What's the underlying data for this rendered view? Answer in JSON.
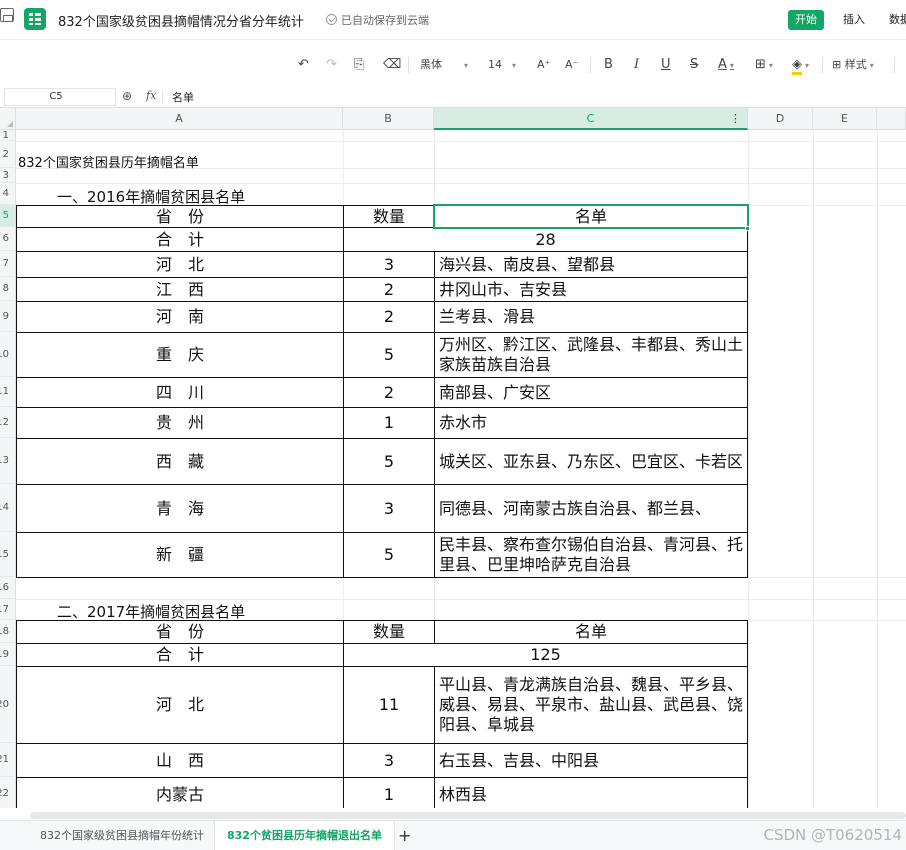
{
  "titlebar": {
    "doc_title": "832个国家级贫困县摘帽情况分省分年统计",
    "save_status": "已自动保存到云端",
    "menu": [
      "开始",
      "插入",
      "数据"
    ]
  },
  "toolbar": {
    "font_name": "黑体",
    "font_size": "14",
    "increase_font": "A⁺",
    "decrease_font": "A⁻",
    "bold": "B",
    "italic": "I",
    "underline": "U",
    "strikethrough": "S",
    "font_color": "A",
    "style_label": "样式",
    "icons": [
      "undo-icon",
      "redo-icon",
      "format-painter-icon",
      "eraser-icon",
      "border-icon",
      "fill-color-icon",
      "style-icon"
    ]
  },
  "formula_bar": {
    "cell_ref": "C5",
    "fx_label": "fx",
    "value": "名单"
  },
  "columns": [
    "A",
    "B",
    "C",
    "D",
    "E"
  ],
  "selected_column": "C",
  "rows": [
    "1",
    "2",
    "3",
    "4",
    "5",
    "6",
    "7",
    "8",
    "9",
    "10",
    "11",
    "12",
    "13",
    "14",
    "15",
    "16",
    "17",
    "18",
    "19",
    "20",
    "21",
    "22"
  ],
  "selected_row": "5",
  "sheet": {
    "heading": "832个国家贫困县历年摘帽名单",
    "section_2016": "一、2016年摘帽贫困县名单",
    "section_2017": "二、2017年摘帽贫困县名单",
    "table_headers": {
      "province": "省　份",
      "count": "数量",
      "list": "名单"
    },
    "total_label": "合　计",
    "total_2016": "28",
    "total_2017": "125",
    "rows_2016": [
      {
        "province": "河　北",
        "count": "3",
        "list": "海兴县、南皮县、望都县"
      },
      {
        "province": "江　西",
        "count": "2",
        "list": "井冈山市、吉安县"
      },
      {
        "province": "河　南",
        "count": "2",
        "list": "兰考县、滑县"
      },
      {
        "province": "重　庆",
        "count": "5",
        "list": "万州区、黔江区、武隆县、丰都县、秀山土家族苗族自治县"
      },
      {
        "province": "四　川",
        "count": "2",
        "list": "南部县、广安区"
      },
      {
        "province": "贵　州",
        "count": "1",
        "list": "赤水市"
      },
      {
        "province": "西　藏",
        "count": "5",
        "list": "城关区、亚东县、乃东区、巴宜区、卡若区"
      },
      {
        "province": "青　海",
        "count": "3",
        "list": "同德县、河南蒙古族自治县、都兰县、"
      },
      {
        "province": "新　疆",
        "count": "5",
        "list": "民丰县、察布查尔锡伯自治县、青河县、托里县、巴里坤哈萨克自治县"
      }
    ],
    "rows_2017": [
      {
        "province": "河　北",
        "count": "11",
        "list": "平山县、青龙满族自治县、魏县、平乡县、威县、易县、平泉市、盐山县、武邑县、饶阳县、阜城县"
      },
      {
        "province": "山　西",
        "count": "3",
        "list": "右玉县、吉县、中阳县"
      },
      {
        "province": "内蒙古",
        "count": "1",
        "list": "林西县"
      }
    ]
  },
  "sheet_tabs": [
    "832个国家级贫困县摘帽年份统计",
    "832个贫困县历年摘帽退出名单"
  ],
  "active_sheet": 1,
  "add_sheet": "+",
  "watermark": "CSDN @T0620514",
  "colors": {
    "accent": "#13a664",
    "selected_header_bg": "#d7ede3"
  }
}
